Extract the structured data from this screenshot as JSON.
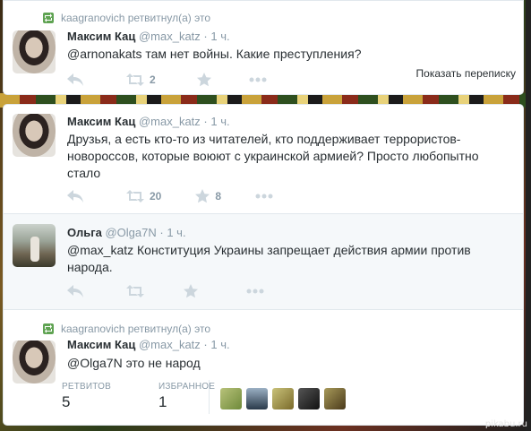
{
  "colors": {
    "retweet_green": "#5fa352",
    "muted": "#8899a6",
    "icon_gray": "#ccd6dd"
  },
  "tweet1": {
    "retweeted_by": "kaagranovich ретвитнул(а) это",
    "name": "Максим Кац",
    "handle": "@max_katz",
    "separator": "·",
    "time": "1 ч.",
    "text": "@arnonakats там нет войны. Какие преступления?",
    "retweets": "2",
    "show_conversation": "Показать переписку"
  },
  "tweet2": {
    "name": "Максим Кац",
    "handle": "@max_katz",
    "separator": "·",
    "time": "1 ч.",
    "text": "Друзья, а есть кто-то из читателей, кто поддерживает террористов-новороссов, которые воюют с украинской армией? Просто любопытно стало",
    "retweets": "20",
    "favorites": "8"
  },
  "tweet3": {
    "name": "Ольга",
    "handle": "@Olga7N",
    "separator": "·",
    "time": "1 ч.",
    "text": "@max_katz Конституция Украины запрещает действия армии против народа."
  },
  "tweet4": {
    "retweeted_by": "kaagranovich ретвитнул(а) это",
    "name": "Максим Кац",
    "handle": "@max_katz",
    "separator": "·",
    "time": "1 ч.",
    "text": "@Olga7N это не народ",
    "stats": {
      "retweets_label": "РЕТВИТОВ",
      "retweets_value": "5",
      "favorites_label": "ИЗБРАННОЕ",
      "favorites_value": "1"
    }
  },
  "icons": [
    "reply-icon",
    "retweet-icon",
    "favorite-icon",
    "more-icon"
  ],
  "watermark": "pikabu.ru"
}
